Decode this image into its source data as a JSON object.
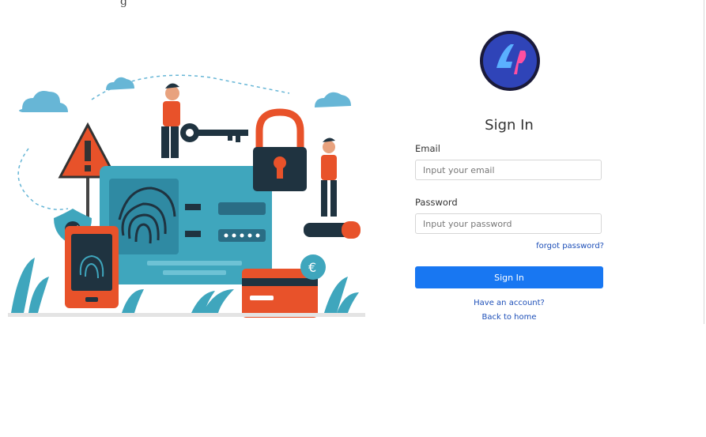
{
  "page": {
    "top_text": "g"
  },
  "login": {
    "logo_text": "4P",
    "title": "Sign In",
    "email_label": "Email",
    "email_placeholder": "Input your email",
    "password_label": "Password",
    "password_placeholder": "Input your password",
    "forgot_link": "forgot password?",
    "sign_in_button": "Sign In",
    "have_account_link": "Have an account?",
    "back_home_link": "Back to home"
  },
  "colors": {
    "primary": "#1877f2",
    "link": "#1d4fb8",
    "logo_bg": "#2f44b8",
    "illustration_teal": "#3fa6bd",
    "illustration_orange": "#e8522a"
  }
}
